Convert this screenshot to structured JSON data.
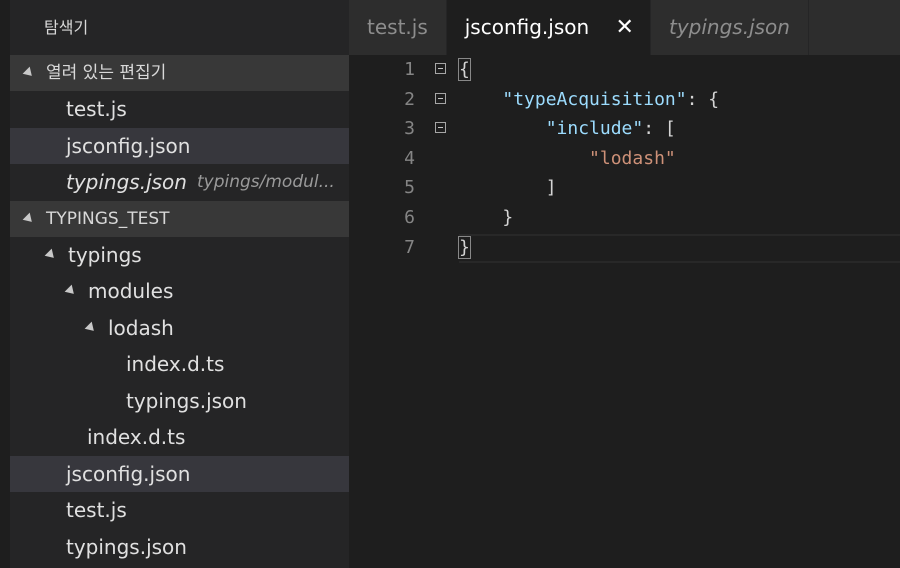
{
  "sidebar": {
    "title": "탐색기",
    "open_editors": {
      "header": "열려 있는 편집기",
      "items": [
        {
          "label": "test.js"
        },
        {
          "label": "jsconfig.json"
        },
        {
          "label": "typings.json",
          "description": "typings/modul..."
        }
      ]
    },
    "project": {
      "header": "TYPINGS_TEST",
      "tree": [
        {
          "label": "typings"
        },
        {
          "label": "modules"
        },
        {
          "label": "lodash"
        },
        {
          "label": "index.d.ts"
        },
        {
          "label": "typings.json"
        },
        {
          "label": "index.d.ts"
        },
        {
          "label": "jsconfig.json"
        },
        {
          "label": "test.js"
        },
        {
          "label": "typings.json"
        }
      ]
    }
  },
  "tabs": [
    {
      "label": "test.js"
    },
    {
      "label": "jsconfig.json",
      "close": "✕"
    },
    {
      "label": "typings.json"
    }
  ],
  "editor": {
    "line_numbers": [
      "1",
      "2",
      "3",
      "4",
      "5",
      "6",
      "7"
    ],
    "lines": [
      {
        "text": "{"
      },
      {
        "indent": "    ",
        "key": "\"typeAcquisition\"",
        "rest": ": {"
      },
      {
        "indent": "        ",
        "key": "\"include\"",
        "rest": ": ["
      },
      {
        "indent": "            ",
        "str": "\"lodash\""
      },
      {
        "text": "        ]"
      },
      {
        "text": "    }"
      },
      {
        "text": "}"
      }
    ]
  },
  "colors": {
    "key": "#9cdcfe",
    "string": "#ce9178",
    "sidebar_bg": "#252526",
    "editor_bg": "#1e1e1e"
  }
}
